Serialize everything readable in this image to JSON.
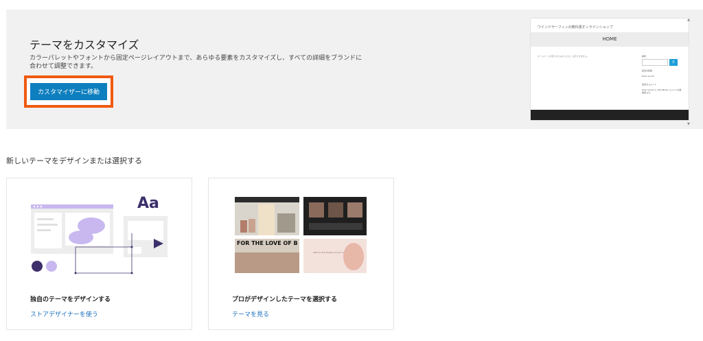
{
  "hero": {
    "title": "テーマをカスタマイズ",
    "description": "カラーパレットやフォントから固定ページレイアウトまで、あらゆる要素をカスタマイズし、すべての詳細をブランドに合わせて調整できます。",
    "button_label": "カスタマイザーに移動",
    "highlight_color": "#f05a10",
    "button_color": "#0d7fbf"
  },
  "preview": {
    "site_title": "ウインドサーフィンの教科書オンラインショップ",
    "menu_item": "HOME",
    "post_text": "ホームページが見つからなかったか、表示できません。",
    "sidebar_search": "検索",
    "search_button_icon": "search-icon",
    "sidebar_recent": "最近の投稿",
    "sidebar_recent_item": "Hello world!",
    "sidebar_comments": "最近のコメント",
    "sidebar_comment_item": "Hello world! に WordPress コメントの投稿者 より"
  },
  "section": {
    "heading": "新しいテーマをデザインまたは選択する"
  },
  "cards": [
    {
      "title": "独自のテーマをデザインする",
      "link": "ストアデザイナーを使う",
      "illustration_text": "Aa"
    },
    {
      "title": "プロがデザインしたテーマを選択する",
      "link": "テーマを見る",
      "thumb_text_1": "FOR THE LOVE OF B",
      "thumb_text_2": "Gifts for the Flowers of Your Life"
    }
  ],
  "colors": {
    "link": "#1a6fbf",
    "accent_purple": "#3d2f6b",
    "light_purple": "#c8b8ef"
  }
}
